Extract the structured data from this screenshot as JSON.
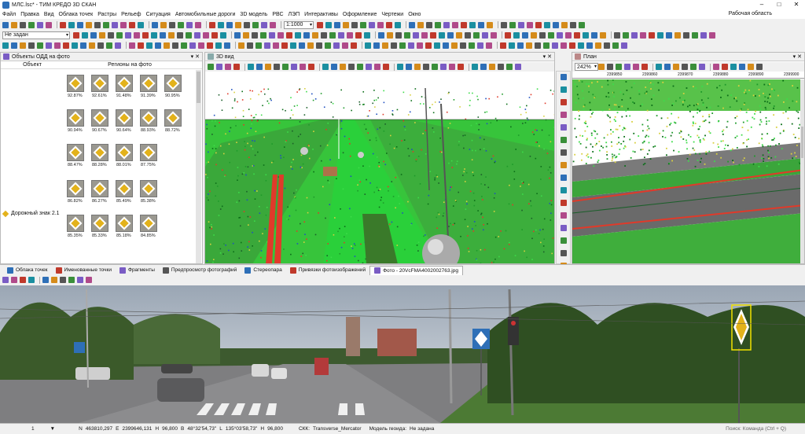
{
  "window": {
    "title": "МЛС.lsc* - ТИМ КРЕДО 3D СКАН",
    "workspace": "Рабочая область"
  },
  "menu": [
    "Файл",
    "Правка",
    "Вид",
    "Облака точек",
    "Растры",
    "Рельеф",
    "Ситуация",
    "Автомобильные дороги",
    "3D модель",
    "РВС",
    "ЛЭП",
    "Интерактивы",
    "Оформление",
    "Чертежи",
    "Окно"
  ],
  "toolbar": {
    "scale": "1:1000",
    "layer_select": "Не задан"
  },
  "left_panel": {
    "title": "Объекты ОДД на фото",
    "col_object": "Объект",
    "col_regions": "Регионы на фото",
    "object_name": "Дорожный знак 2.1",
    "thumb_rows": [
      [
        "92.87%",
        "92.61%",
        "91.48%",
        "91.39%",
        "90.95%"
      ],
      [
        "90.94%",
        "90.67%",
        "90.64%",
        "88.93%",
        "88.72%"
      ],
      [
        "88.47%",
        "88.28%",
        "88.01%",
        "87.75%"
      ],
      [
        "86.82%",
        "86.27%",
        "85.49%",
        "85.38%"
      ],
      [
        "85.35%",
        "85.33%",
        "85.18%",
        "84.85%"
      ]
    ]
  },
  "view3d": {
    "title": "3D вид"
  },
  "plan": {
    "title": "План",
    "zoom": "242%",
    "ruler": [
      "2399850",
      "2399860",
      "2399870",
      "2399880",
      "2399890",
      "2399900"
    ]
  },
  "bottom_tabs": [
    "Облака точек",
    "Именованные точки",
    "Фрагменты",
    "Предпросмотр фотографий",
    "Стереопара",
    "Привязки фотоизображений",
    "Фото - 20VcFMA4002002763.jpg"
  ],
  "status": {
    "n": "N",
    "n_val": "463810,297",
    "e": "E",
    "e_val": "2399646,131",
    "h": "H",
    "h_val": "96,800",
    "b": "B",
    "b_val": "48°32'54,73\"",
    "l": "L",
    "l_val": "135°03'58,73\"",
    "h2": "H",
    "h2_val": "96,800",
    "sk_label": "СКК:",
    "sk_val": "Transverse_Mercator",
    "geoid_label": "Модель геоида:",
    "geoid_val": "Не задана",
    "search": "Поиск: Команда (Ctrl + Q)",
    "count": "1"
  },
  "colors": {
    "accent": "#2e6fb7",
    "sign_yellow": "#e3b21b",
    "cloud_green": "#2fd32f",
    "cloud_red": "#e03a2a"
  }
}
